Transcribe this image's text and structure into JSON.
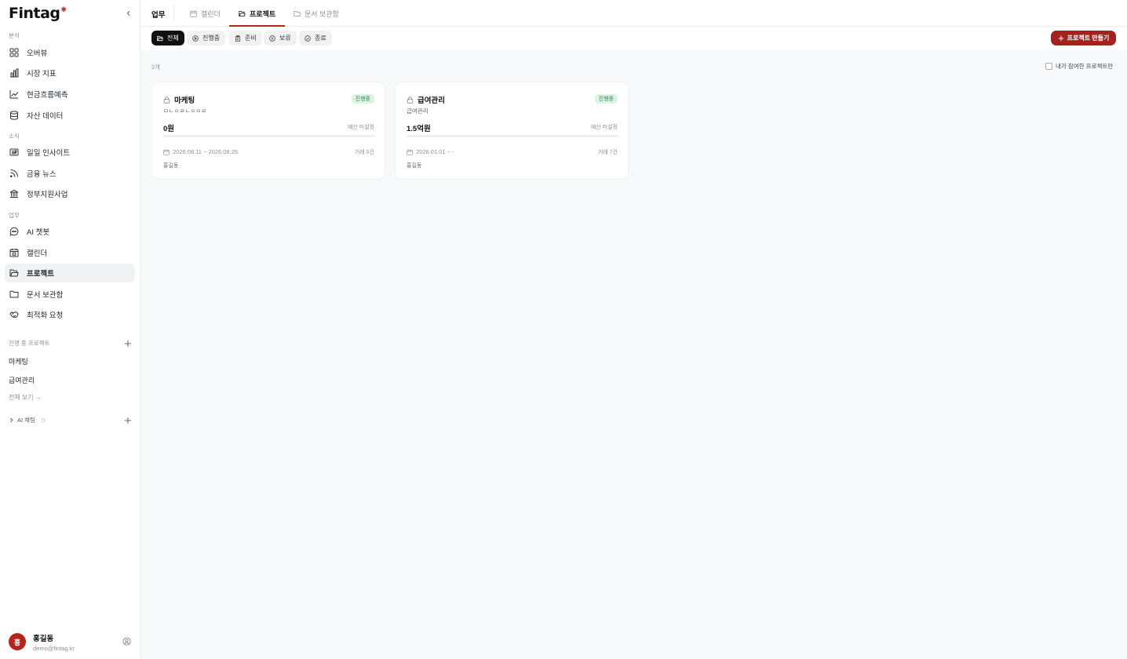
{
  "app": {
    "logo_text": "Fintag",
    "logo_mark": "✱"
  },
  "sidebar": {
    "sections": {
      "analysis": "분석",
      "news": "소식",
      "work": "업무",
      "in_progress": "진행 중 프로젝트"
    },
    "analysis_items": [
      {
        "label": "오버뷰",
        "icon": "grid-icon"
      },
      {
        "label": "시장 지표",
        "icon": "bar-chart-icon"
      },
      {
        "label": "현금흐름예측",
        "icon": "trend-line-icon"
      },
      {
        "label": "자산 데이터",
        "icon": "database-icon"
      }
    ],
    "news_items": [
      {
        "label": "일일 인사이트",
        "icon": "newspaper-icon"
      },
      {
        "label": "금융 뉴스",
        "icon": "rss-icon"
      },
      {
        "label": "정부지원사업",
        "icon": "bank-icon"
      }
    ],
    "work_items": [
      {
        "label": "AI 챗봇",
        "icon": "chat-bubble-icon"
      },
      {
        "label": "캘린더",
        "icon": "calendar-icon"
      },
      {
        "label": "프로젝트",
        "icon": "folder-open-icon",
        "active": true
      },
      {
        "label": "문서 보관함",
        "icon": "folder-icon"
      },
      {
        "label": "최적화 요청",
        "icon": "handshake-icon"
      }
    ],
    "projects": [
      "마케팅",
      "급여관리"
    ],
    "view_all": "전체 보기 →",
    "ai_chat": {
      "label": "AI 채팅",
      "count": "0"
    },
    "user": {
      "initial": "홍",
      "name": "홍길동",
      "email": "demo@fintag.kr"
    }
  },
  "topbar": {
    "title": "업무",
    "tabs": [
      {
        "label": "캘린더",
        "icon": "calendar-icon",
        "active": false
      },
      {
        "label": "프로젝트",
        "icon": "folder-open-icon",
        "active": true
      },
      {
        "label": "문서 보관함",
        "icon": "folder-icon",
        "active": false
      }
    ]
  },
  "filters": {
    "chips": [
      {
        "label": "전체",
        "icon": "folder-open-icon",
        "active": true
      },
      {
        "label": "진행중",
        "icon": "play-circle-icon",
        "active": false
      },
      {
        "label": "준비",
        "icon": "clipboard-icon",
        "active": false
      },
      {
        "label": "보류",
        "icon": "pause-circle-icon",
        "active": false
      },
      {
        "label": "종료",
        "icon": "check-circle-icon",
        "active": false
      }
    ],
    "create_label": "프로젝트 만들기"
  },
  "main": {
    "count": "2개",
    "mine_only": "내가 참여한 프로젝트만",
    "cards": [
      {
        "title": "마케팅",
        "subtitle": "ㅁㄴㅇㄹㄴㅇㅇㄹ",
        "status": "진행중",
        "budget": "0원",
        "budget_note": "예산 미설정",
        "progress": 0,
        "dates": "2026.08.11 ~ 2026.08.25",
        "transactions": "거래 0건",
        "owner": "홍길동"
      },
      {
        "title": "급여관리",
        "subtitle": "급여관리",
        "status": "진행중",
        "budget": "1.5억원",
        "budget_note": "예산 미설정",
        "progress": 0,
        "dates": "2026.01.01 ~ -",
        "transactions": "거래 7건",
        "owner": "홍길동"
      }
    ]
  },
  "colors": {
    "brand": "#b3261e",
    "badge_bg": "#dff3e4",
    "badge_text": "#2e8b57"
  }
}
